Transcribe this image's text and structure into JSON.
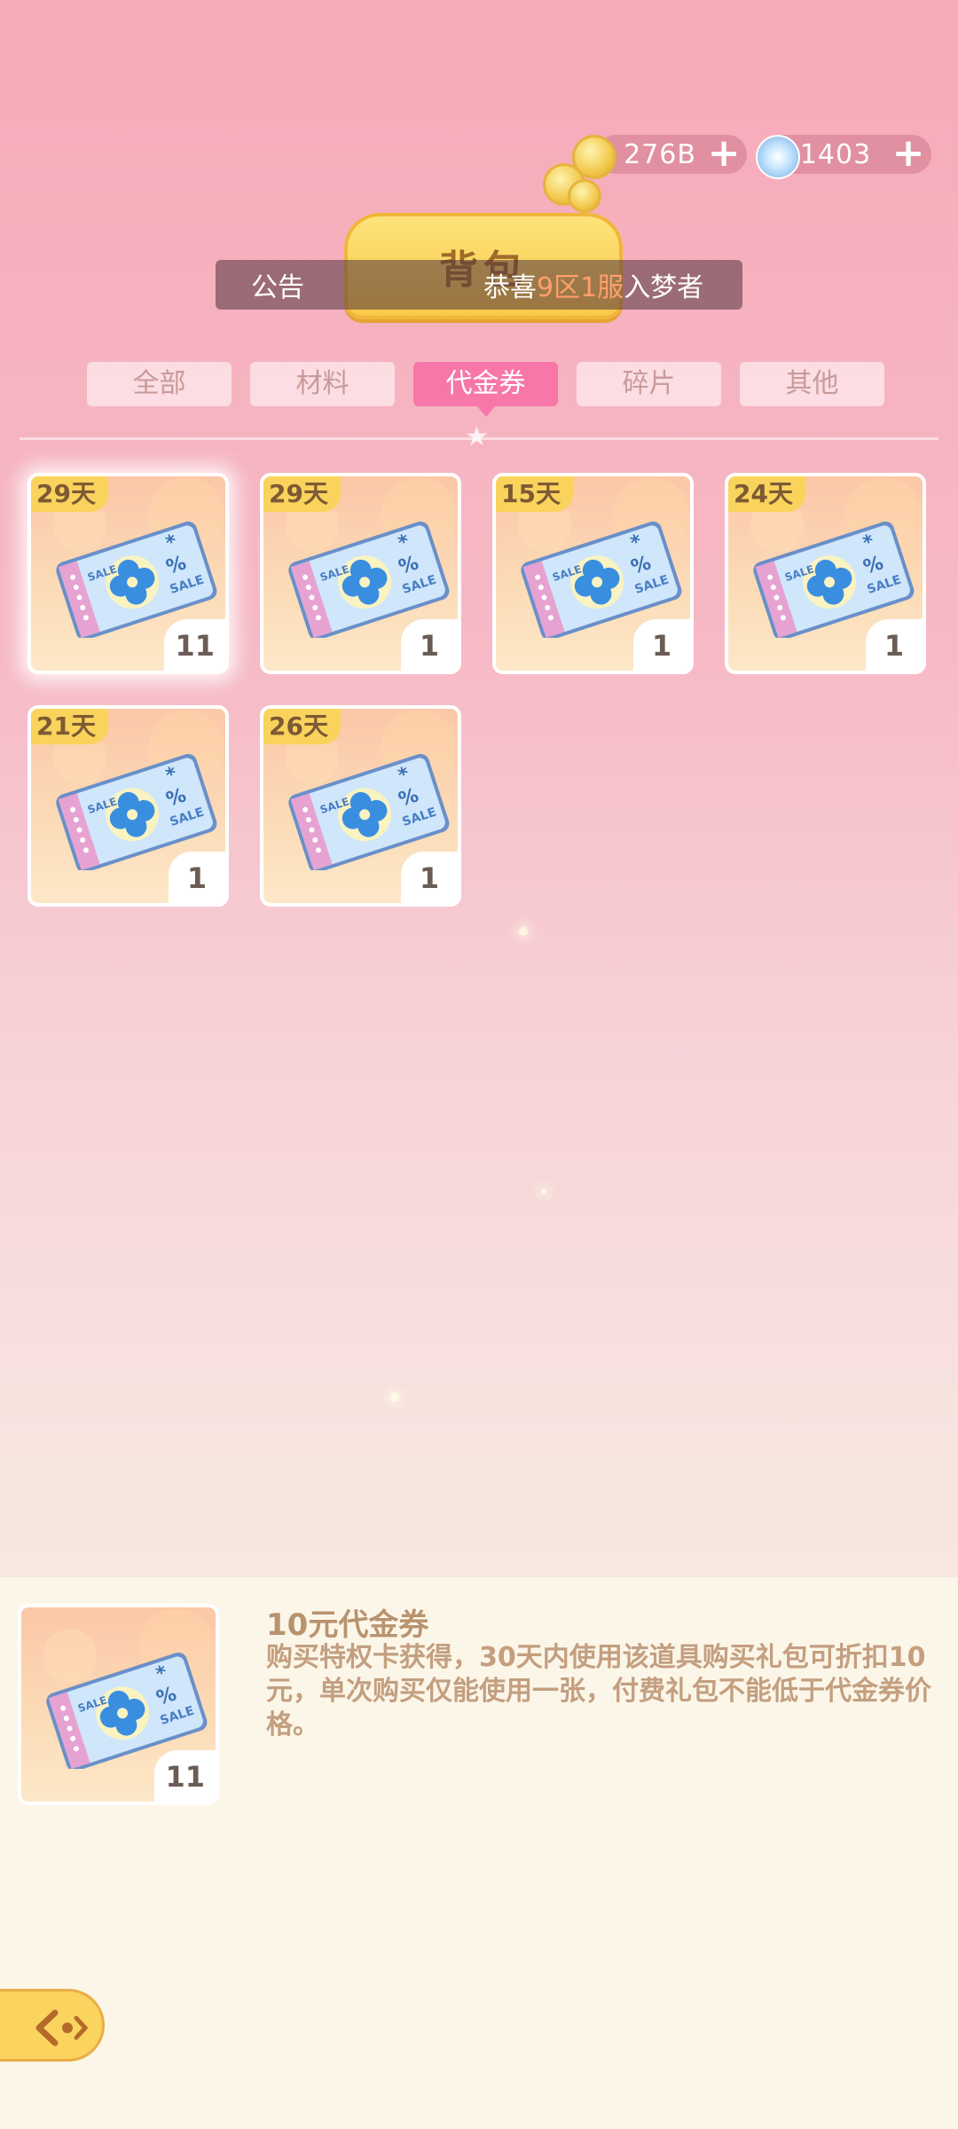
{
  "currency": {
    "gold": "276B",
    "gems": "1403"
  },
  "header": {
    "title": "背包",
    "announcement": {
      "label": "公告",
      "prefix": "恭喜",
      "highlight": "9区1服",
      "suffix": "入梦者"
    }
  },
  "tabs": [
    "全部",
    "材料",
    "代金券",
    "碎片",
    "其他"
  ],
  "active_tab": "代金券",
  "items": [
    {
      "days": "29天",
      "count": "11"
    },
    {
      "days": "29天",
      "count": "1"
    },
    {
      "days": "15天",
      "count": "1"
    },
    {
      "days": "24天",
      "count": "1"
    },
    {
      "days": "21天",
      "count": "1"
    },
    {
      "days": "26天",
      "count": "1"
    }
  ],
  "detail": {
    "title": "10元代金券",
    "description": "购买特权卡获得，30天内使用该道具购买礼包可折扣10元，单次购买仅能使用一张，付费礼包不能低于代金券价格。",
    "count": "11"
  },
  "icons": {
    "back": "back-arrow-icon",
    "gold": "gold-coin-icon",
    "gem": "gem-icon",
    "voucher": "voucher-ticket-icon"
  },
  "colors": {
    "active_tab": "#f777a8",
    "days_badge": "#f9d35b",
    "highlight": "#ff9f6a"
  }
}
